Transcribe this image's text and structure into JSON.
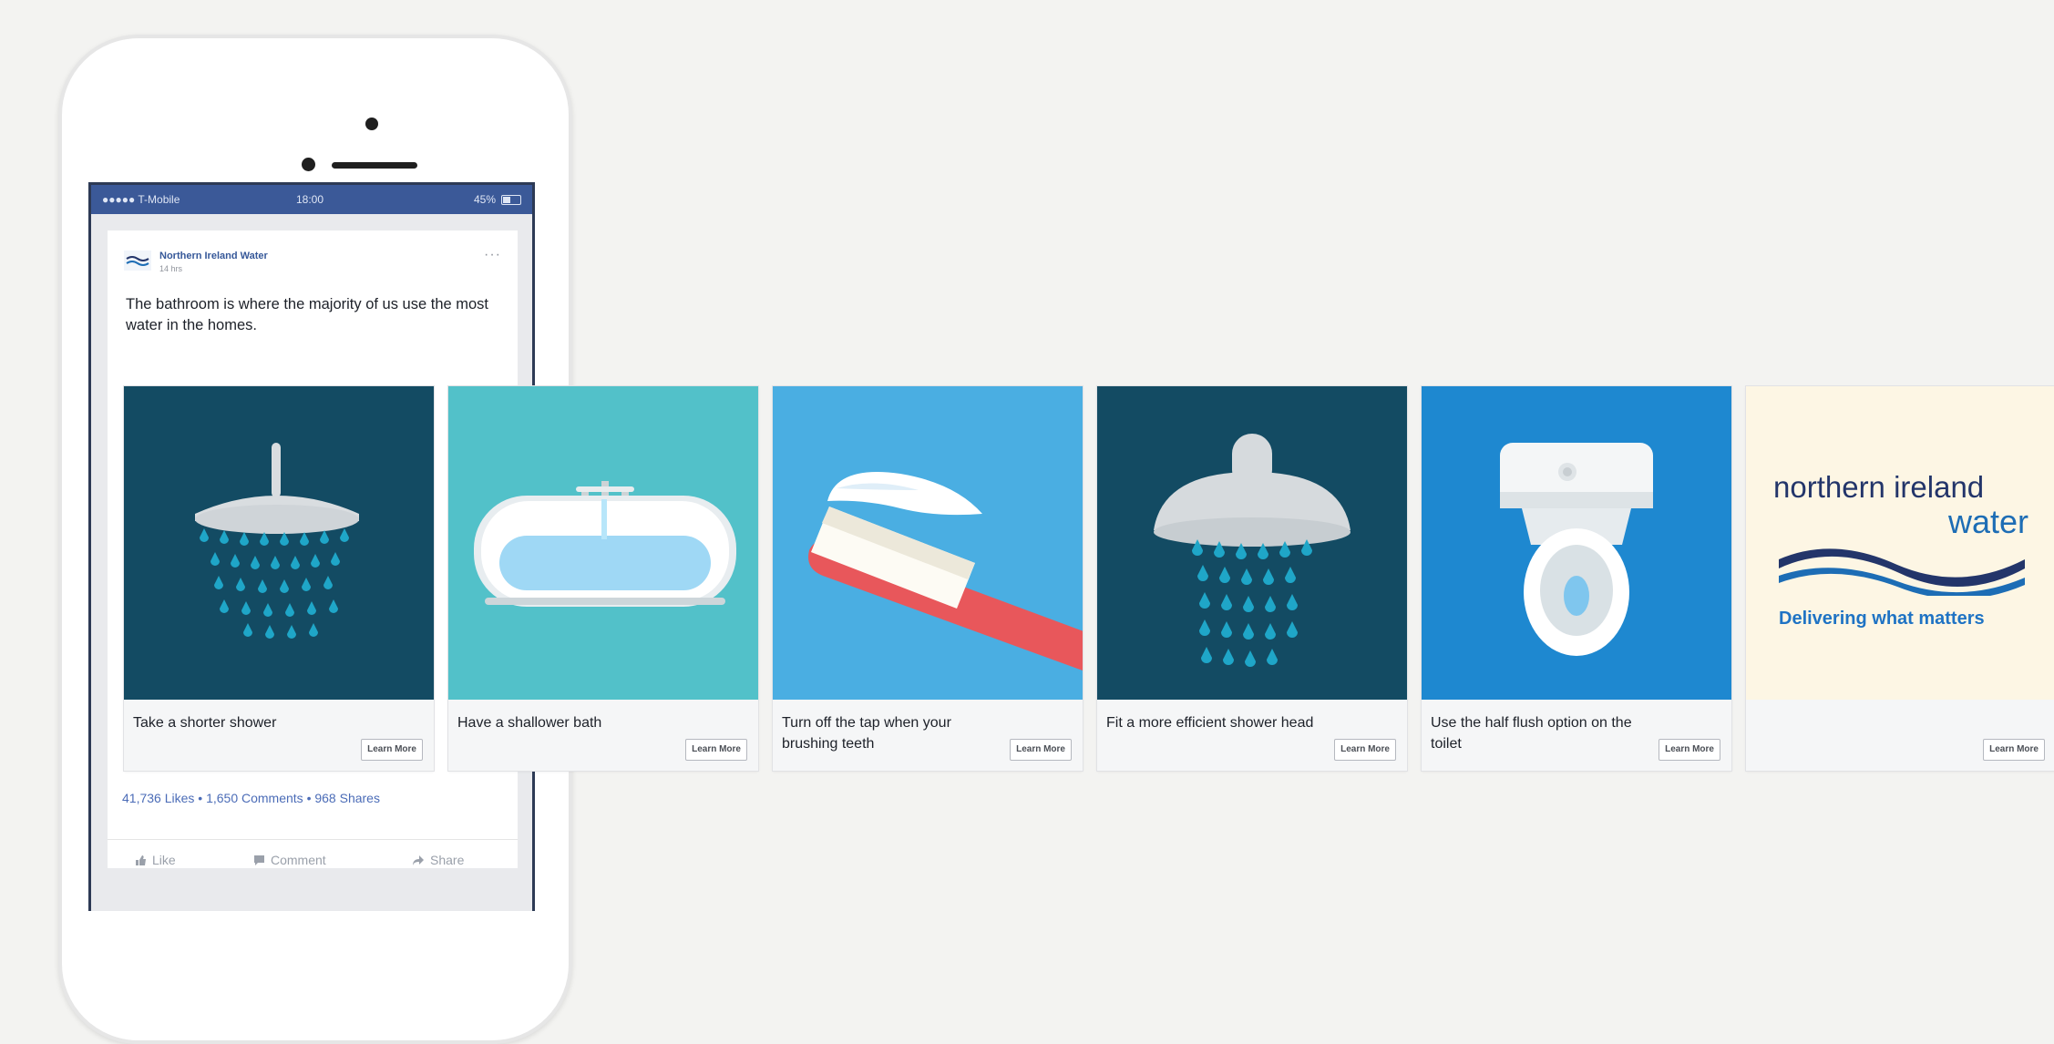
{
  "status_bar": {
    "carrier": "●●●●● T-Mobile",
    "time": "18:00",
    "battery": "45%"
  },
  "post": {
    "page_name": "Northern Ireland Water",
    "time": "14 hrs",
    "more_label": "···",
    "text": "The bathroom is where the majority of us use the most water in the homes.",
    "stats": "41,736 Likes • 1,650 Comments • 968 Shares",
    "actions": {
      "like": "Like",
      "comment": "Comment",
      "share": "Share"
    }
  },
  "carousel": [
    {
      "caption": "Take a shorter shower",
      "button": "Learn More",
      "image": "shower-icon",
      "bg": "#134b63"
    },
    {
      "caption": "Have a shallower bath",
      "button": "Learn More",
      "image": "bathtub-icon",
      "bg": "#52c1c9"
    },
    {
      "caption": "Turn off the tap when your brushing teeth",
      "button": "Learn More",
      "image": "toothbrush-icon",
      "bg": "#4aaee2"
    },
    {
      "caption": "Fit a more efficient shower head",
      "button": "Learn More",
      "image": "shower-head-icon",
      "bg": "#134b63"
    },
    {
      "caption": "Use the half flush option on the toilet",
      "button": "Learn More",
      "image": "toilet-icon",
      "bg": "#1e88d0"
    },
    {
      "caption": "",
      "button": "Learn More",
      "image": "ni-water-logo",
      "bg": "#fdf6e4"
    }
  ],
  "logo": {
    "line1": "northern ireland",
    "line2": "water",
    "tagline": "Delivering what matters"
  },
  "colors": {
    "facebook_blue": "#3b5998",
    "drop_blue": "#1fa6c8",
    "page_background": "#f3f3f1"
  }
}
